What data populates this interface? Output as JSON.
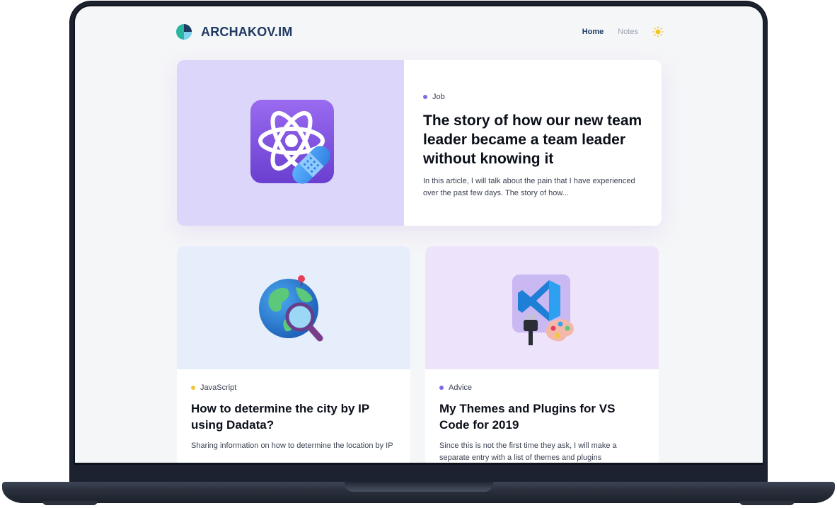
{
  "site": {
    "logo_text": "ARCHAKOV.IM",
    "nav": [
      {
        "label": "Home",
        "active": true
      },
      {
        "label": "Notes",
        "active": false
      }
    ],
    "theme_icon": "sun-icon"
  },
  "featured": {
    "category": "Job",
    "category_color": "#7b6ee0",
    "title": "The story of how our new team leader became a team leader without knowing it",
    "excerpt": "In this article, I will talk about the pain that I have experienced over the past few days. The story of how...",
    "image_icon": "react-atom-bandage-icon"
  },
  "cards": [
    {
      "category": "JavaScript",
      "category_color": "#f0c93a",
      "title": "How to determine the city by IP using Dadata?",
      "excerpt": "Sharing information on how to determine the location by IP",
      "image_icon": "globe-magnifier-icon"
    },
    {
      "category": "Advice",
      "category_color": "#7b6ee0",
      "title": "My Themes and Plugins for VS Code for 2019",
      "excerpt": "Since this is not the first time they ask, I will make a separate entry with a list of themes and plugins",
      "image_icon": "vscode-plugin-palette-icon"
    }
  ],
  "colors": {
    "brand": "#1f3a63",
    "page_bg": "#f5f6f8",
    "featured_media_bg": "#ddd6fb"
  }
}
